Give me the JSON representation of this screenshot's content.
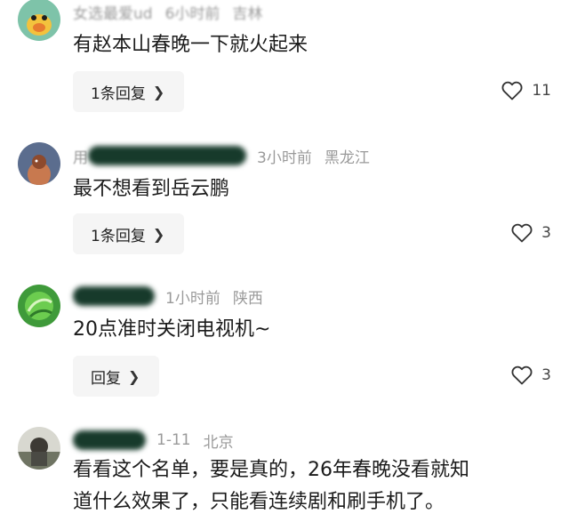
{
  "comments": [
    {
      "username_partial": "女选",
      "username_tail": "最爱ud",
      "time": "6小时前",
      "location": "吉林",
      "text": "有赵本山春晚一下就火起来",
      "reply_label": "1条回复",
      "likes": "11"
    },
    {
      "username_partial": "用",
      "time": "3小时前",
      "location": "黑龙江",
      "text": "最不想看到岳云鹏",
      "reply_label": "1条回复",
      "likes": "3"
    },
    {
      "username_partial": "",
      "time": "1小时前",
      "location": "陕西",
      "text": "20点准时关闭电视机~",
      "reply_label": "回复",
      "likes": "3"
    },
    {
      "username_partial": "",
      "time": "1-11",
      "location": "北京",
      "text_line1": "看看这个名单，要是真的，26年春晚没看就知",
      "text_line2": "道什么效果了，只能看连续剧和刷手机了。"
    }
  ],
  "icons": {
    "like": "heart-outline-icon",
    "chevron": "chevron-right-icon"
  },
  "colors": {
    "meta_text": "#9a9a9a",
    "reply_bg": "#f5f5f5",
    "redaction": "#173a2b"
  }
}
